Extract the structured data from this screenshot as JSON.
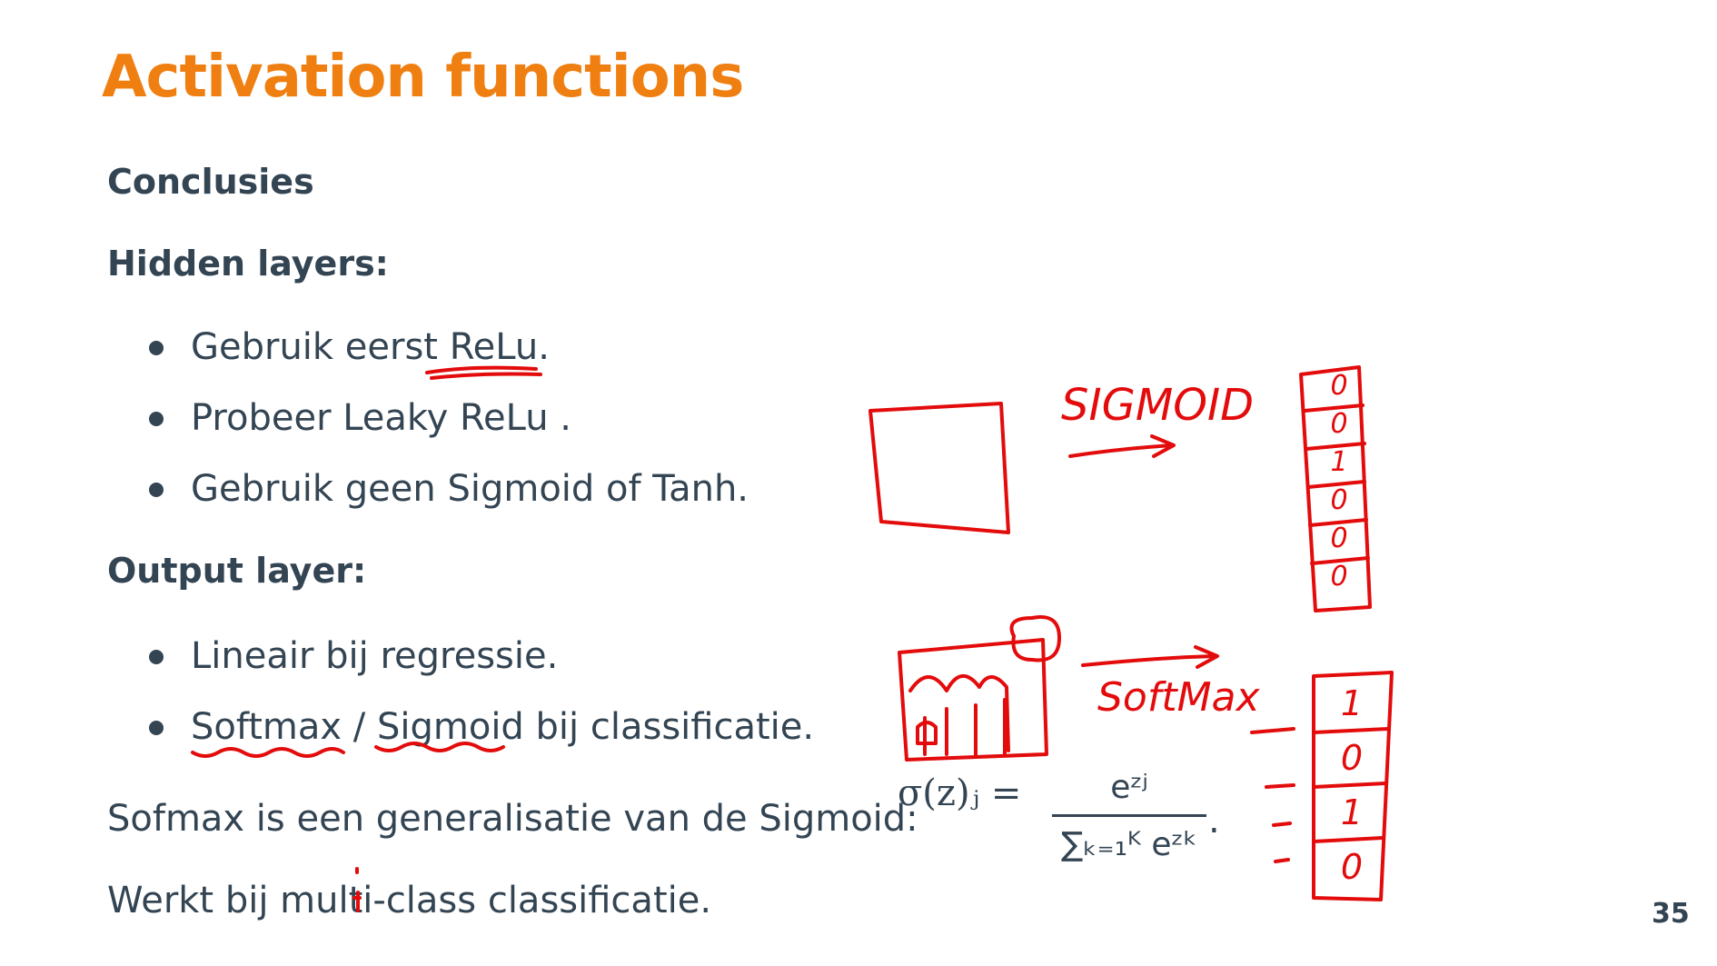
{
  "slide": {
    "title": "Activation functions",
    "subtitle": "Conclusies",
    "hidden_heading": "Hidden layers:",
    "hidden_items": [
      "Gebruik eerst ReLu.",
      "Probeer Leaky ReLu .",
      "Gebruik geen Sigmoid of Tanh."
    ],
    "output_heading": "Output layer:",
    "output_items": [
      "Lineair bij regressie.",
      "Softmax / Sigmoid bij classificatie."
    ],
    "softmax_sentence": "Sofmax is een generalisatie van de Sigmoid:",
    "formula_lhs": "σ(z)ⱼ =",
    "formula_numerator": "eᶻʲ",
    "formula_denominator": "∑ₖ₌₁ᴷ eᶻᵏ",
    "formula_end": ".",
    "multiclass_sentence": "Werkt bij multi-class classificatie.",
    "page_number": "35"
  },
  "annotations": {
    "sigmoid_label": "SIGMOID",
    "softmax_label": "SoftMax",
    "sigmoid_vector": [
      "0",
      "0",
      "1",
      "0",
      "0",
      "0"
    ],
    "softmax_vector": [
      "1",
      "0",
      "1",
      "0"
    ],
    "ink_color": "#e30b0b"
  },
  "colors": {
    "title": "#f07f12",
    "text": "#334453",
    "ink": "#e30b0b"
  }
}
